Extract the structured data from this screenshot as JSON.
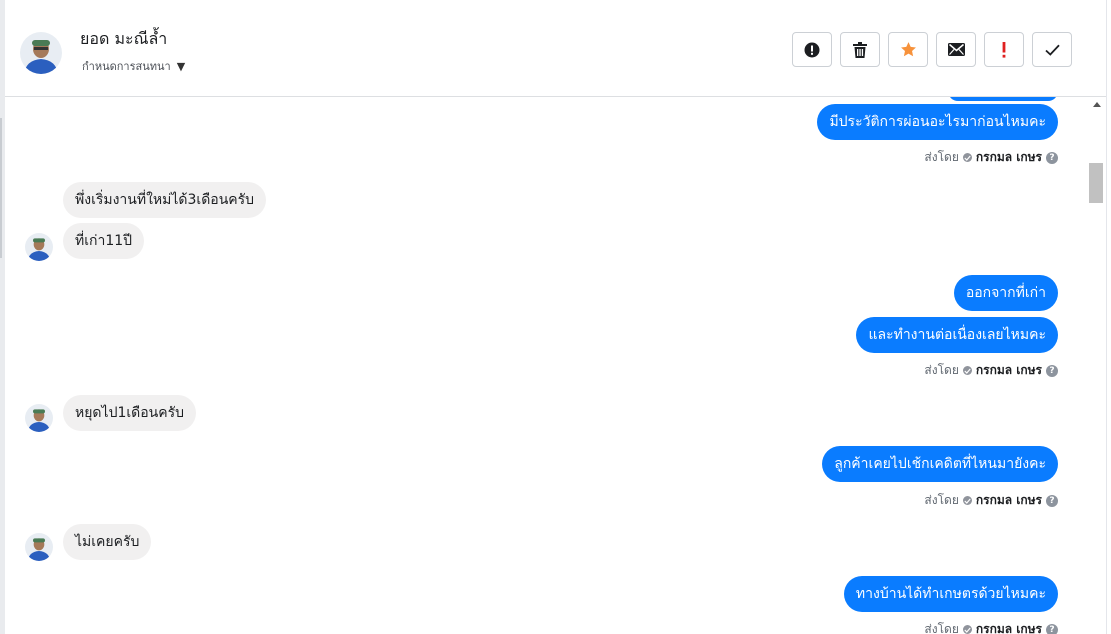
{
  "header": {
    "contact_name": "ยอด มะณีล้ำ",
    "conversation_settings_label": "กำหนดการสนทนา",
    "toolbar": [
      {
        "name": "spam-button",
        "icon": "alert-circle-icon"
      },
      {
        "name": "delete-button",
        "icon": "trash-icon"
      },
      {
        "name": "star-button",
        "icon": "star-icon",
        "color": "#f7923b"
      },
      {
        "name": "mark-unread-button",
        "icon": "envelope-icon"
      },
      {
        "name": "follow-up-button",
        "icon": "exclamation-icon",
        "color": "#e02020"
      },
      {
        "name": "done-button",
        "icon": "checkmark-icon"
      }
    ]
  },
  "messages": [
    {
      "id": "m1",
      "side": "out",
      "text": "มีประวัติการผ่อนอะไรมาก่อนไหมคะ"
    },
    {
      "id": "m2",
      "side": "in",
      "text": "พึ่งเริ่มงานที่ใหม่ได้3เดือนครับ"
    },
    {
      "id": "m3",
      "side": "in",
      "text": "ที่เก่า11ปี"
    },
    {
      "id": "m4",
      "side": "out",
      "text": "ออกจากที่เก่า"
    },
    {
      "id": "m5",
      "side": "out",
      "text": "และทำงานต่อเนื่องเลยไหมคะ"
    },
    {
      "id": "m6",
      "side": "in",
      "text": "หยุดไป1เดือนครับ"
    },
    {
      "id": "m7",
      "side": "out",
      "text": "ลูกค้าเคยไปเช้กเคดิตที่ไหนมายังคะ"
    },
    {
      "id": "m8",
      "side": "in",
      "text": "ไม่เคยครับ"
    },
    {
      "id": "m9",
      "side": "out",
      "text": "ทางบ้านได้ทำเกษตรด้วยไหมคะ"
    }
  ],
  "sent_by": {
    "prefix": "ส่งโดย",
    "agent_name": "กรกมล เกษร",
    "help_symbol": "?"
  },
  "colors": {
    "outgoing_bubble": "#0a7cff",
    "incoming_bubble": "#f1f0f0"
  }
}
